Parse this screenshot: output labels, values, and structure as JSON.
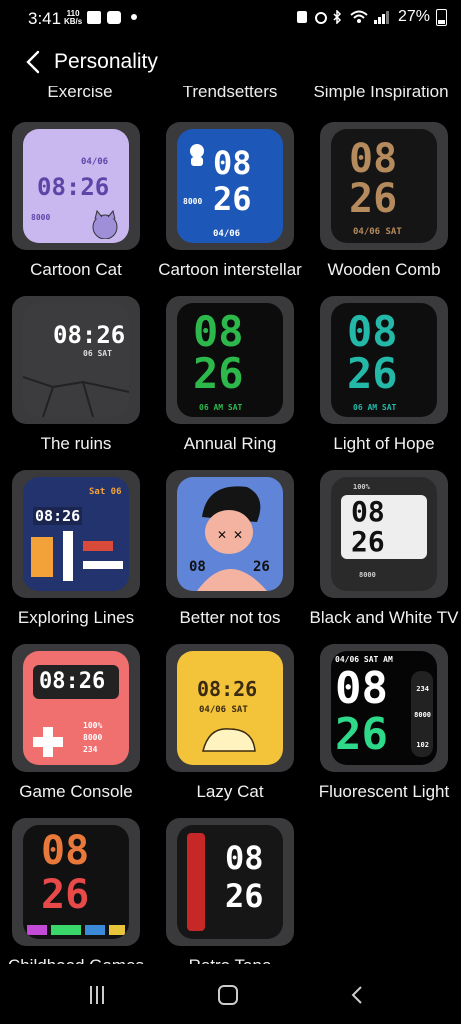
{
  "status_bar": {
    "time": "3:41",
    "kbps_top": "110",
    "kbps_bottom": "KB/s",
    "battery": "27%"
  },
  "header": {
    "title": "Personality"
  },
  "partial_labels": [
    "Exercise",
    "Trendsetters",
    "Simple Inspiration"
  ],
  "faces": [
    {
      "label": "Cartoon Cat",
      "hour": "08",
      "min": "26",
      "date": "04/06"
    },
    {
      "label": "Cartoon interstellar",
      "hour": "08",
      "min": "26",
      "date": "04/06"
    },
    {
      "label": "Wooden Comb",
      "hour": "08",
      "min": "26",
      "date": "04/06 SAT"
    },
    {
      "label": "The ruins",
      "hour": "08",
      "min": "26",
      "date": "06 SAT"
    },
    {
      "label": "Annual Ring",
      "hour": "08",
      "min": "26",
      "date": "06 AM SAT"
    },
    {
      "label": "Light of Hope",
      "hour": "08",
      "min": "26",
      "date": "06 AM SAT"
    },
    {
      "label": "Exploring Lines",
      "hour": "08",
      "min": "26",
      "date": "Sat 06"
    },
    {
      "label": "Better not tos",
      "hour": "08",
      "min": "26",
      "date": ""
    },
    {
      "label": "Black and White TV",
      "hour": "08",
      "min": "26",
      "date": "100%"
    },
    {
      "label": "Game Console",
      "hour": "08",
      "min": "26",
      "date": "100%"
    },
    {
      "label": "Lazy Cat",
      "hour": "08",
      "min": "26",
      "date": "04/06 SAT"
    },
    {
      "label": "Fluorescent Light",
      "hour": "08",
      "min": "26",
      "date": "04/06 SAT AM"
    },
    {
      "label": "Childhood Games",
      "hour": "08",
      "min": "26",
      "date": ""
    },
    {
      "label": "Retro Tape",
      "hour": "08",
      "min": "26",
      "date": ""
    }
  ],
  "face_stats": {
    "steps": "8000",
    "heart": "102",
    "cal": "234"
  }
}
